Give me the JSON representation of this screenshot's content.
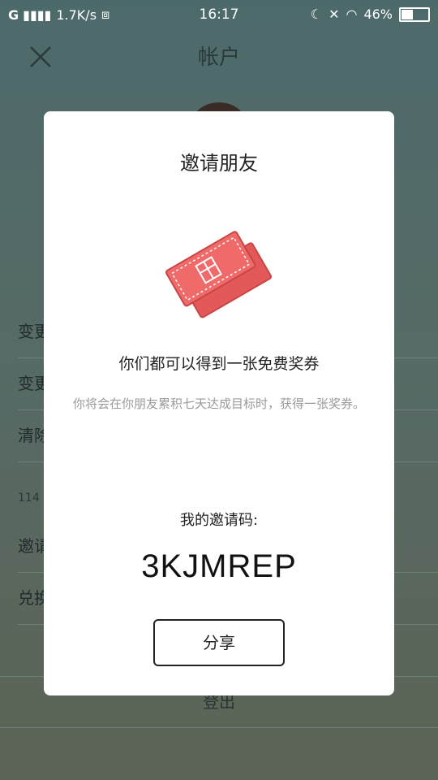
{
  "status_bar": {
    "signal": "G",
    "net_speed": "1.7K/s",
    "time": "16:17",
    "battery_percent": "46%",
    "battery_level": 0.46
  },
  "header": {
    "title": "帐户"
  },
  "background_rows": [
    "变更",
    "变更",
    "清除",
    "邀请",
    "兑换"
  ],
  "background_small": "114",
  "logout_label": "登出",
  "dialog": {
    "title": "邀请朋友",
    "heading": "你们都可以得到一张免费奖券",
    "description": "你将会在你朋友累积七天达成目标时，获得一张奖券。",
    "code_label": "我的邀请码:",
    "code": "3KJMREP",
    "share_label": "分享",
    "ticket_color": "#f06a6a"
  }
}
